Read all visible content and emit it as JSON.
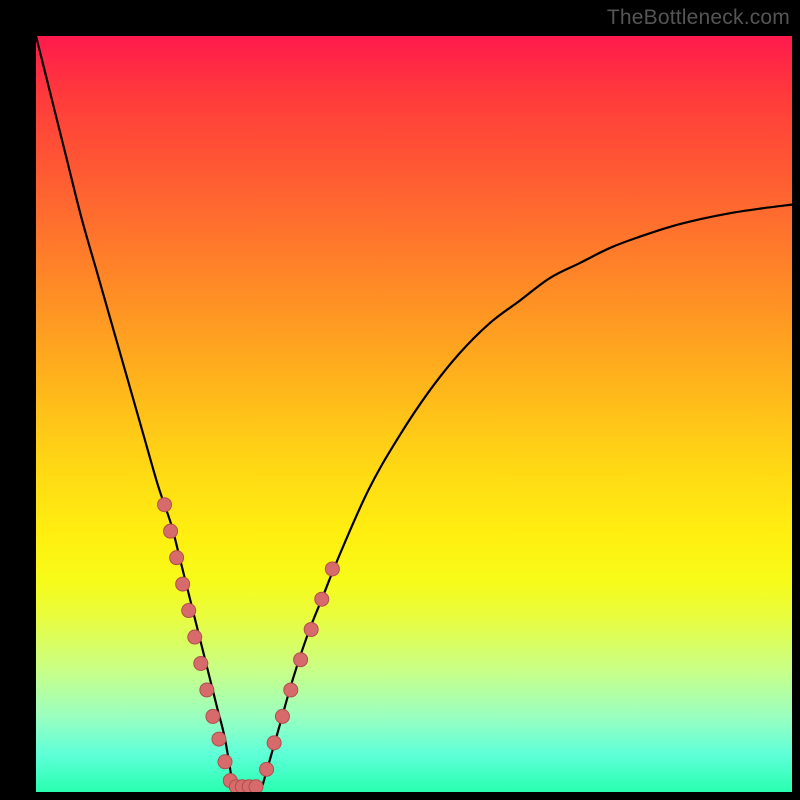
{
  "watermark": "TheBottleneck.com",
  "chart_data": {
    "type": "line",
    "title": "",
    "xlabel": "",
    "ylabel": "",
    "xlim": [
      0,
      100
    ],
    "ylim": [
      0,
      100
    ],
    "series": [
      {
        "name": "left-curve",
        "x": [
          0,
          2,
          4,
          6,
          8,
          10,
          12,
          14,
          16,
          17,
          18,
          19,
          20,
          21,
          22,
          23,
          24,
          25,
          26
        ],
        "y": [
          100,
          92,
          84,
          76,
          69,
          62,
          55,
          48,
          41,
          38,
          35,
          31,
          27,
          23,
          19,
          15,
          11,
          7,
          1
        ]
      },
      {
        "name": "right-curve",
        "x": [
          30,
          32,
          34,
          36,
          38,
          40,
          44,
          48,
          52,
          56,
          60,
          64,
          68,
          72,
          76,
          80,
          84,
          88,
          92,
          96,
          100
        ],
        "y": [
          1,
          8,
          15,
          21,
          26,
          31,
          40,
          47,
          53,
          58,
          62,
          65,
          68,
          70,
          72,
          73.5,
          74.8,
          75.8,
          76.6,
          77.2,
          77.7
        ]
      }
    ],
    "markers": [
      {
        "name": "left-dots",
        "x": [
          17.0,
          17.8,
          18.6,
          19.4,
          20.2,
          21.0,
          21.8,
          22.6,
          23.4,
          24.2,
          25.0,
          25.7
        ],
        "y": [
          38.0,
          34.5,
          31.0,
          27.5,
          24.0,
          20.5,
          17.0,
          13.5,
          10.0,
          7.0,
          4.0,
          1.5
        ]
      },
      {
        "name": "valley-dots",
        "x": [
          26.5,
          27.3,
          28.2,
          29.1
        ],
        "y": [
          0.7,
          0.7,
          0.7,
          0.7
        ]
      },
      {
        "name": "right-dots",
        "x": [
          30.5,
          31.5,
          32.6,
          33.7,
          35.0,
          36.4,
          37.8,
          39.2
        ],
        "y": [
          3.0,
          6.5,
          10.0,
          13.5,
          17.5,
          21.5,
          25.5,
          29.5
        ]
      }
    ],
    "styles": {
      "curve_stroke": "#000000",
      "curve_width": 2.2,
      "marker_fill": "#d76b6b",
      "marker_stroke": "#b24e4e",
      "marker_radius": 7
    }
  }
}
